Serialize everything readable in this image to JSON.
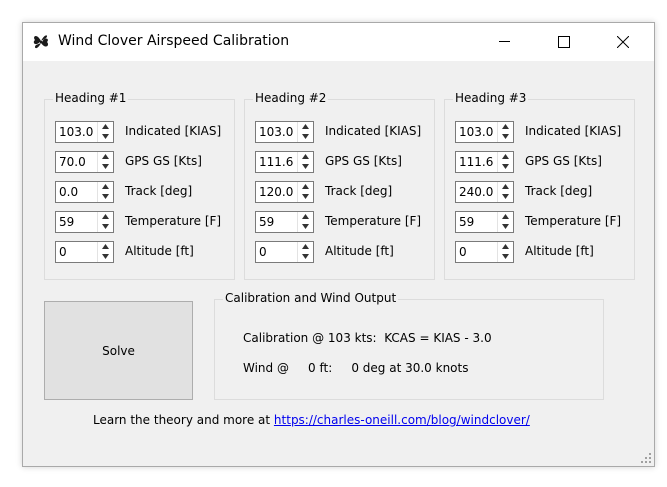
{
  "window": {
    "title": "Wind Clover Airspeed Calibration",
    "icon": "clover-icon",
    "controls": [
      "minimize-icon",
      "maximize-icon",
      "close-icon"
    ]
  },
  "headings": [
    {
      "label": "Heading #1",
      "fields": [
        {
          "value": "103.0",
          "label": "Indicated [KIAS]"
        },
        {
          "value": "70.0",
          "label": "GPS GS [Kts]"
        },
        {
          "value": "0.0",
          "label": "Track [deg]"
        },
        {
          "value": "59",
          "label": "Temperature [F]"
        },
        {
          "value": "0",
          "label": "Altitude [ft]"
        }
      ]
    },
    {
      "label": "Heading #2",
      "fields": [
        {
          "value": "103.0",
          "label": "Indicated [KIAS]"
        },
        {
          "value": "111.6",
          "label": "GPS GS [Kts]"
        },
        {
          "value": "120.0",
          "label": "Track [deg]"
        },
        {
          "value": "59",
          "label": "Temperature [F]"
        },
        {
          "value": "0",
          "label": "Altitude [ft]"
        }
      ]
    },
    {
      "label": "Heading #3",
      "fields": [
        {
          "value": "103.0",
          "label": "Indicated [KIAS]"
        },
        {
          "value": "111.6",
          "label": "GPS GS [Kts]"
        },
        {
          "value": "240.0",
          "label": "Track [deg]"
        },
        {
          "value": "59",
          "label": "Temperature [F]"
        },
        {
          "value": "0",
          "label": "Altitude [ft]"
        }
      ]
    }
  ],
  "solve_label": "Solve",
  "output": {
    "label": "Calibration and Wind Output",
    "calibration": "Calibration @ 103 kts:  KCAS = KIAS - 3.0",
    "wind": "Wind @     0 ft:     0 deg at 30.0 knots"
  },
  "footer": {
    "text": "Learn the theory and more at ",
    "link": "https://charles-oneill.com/blog/windclover/"
  },
  "colors": {
    "window_bg": "#f0f0f0",
    "titlebar_bg": "#ffffff",
    "link": "#0000ee",
    "button_bg": "#e1e1e1"
  }
}
